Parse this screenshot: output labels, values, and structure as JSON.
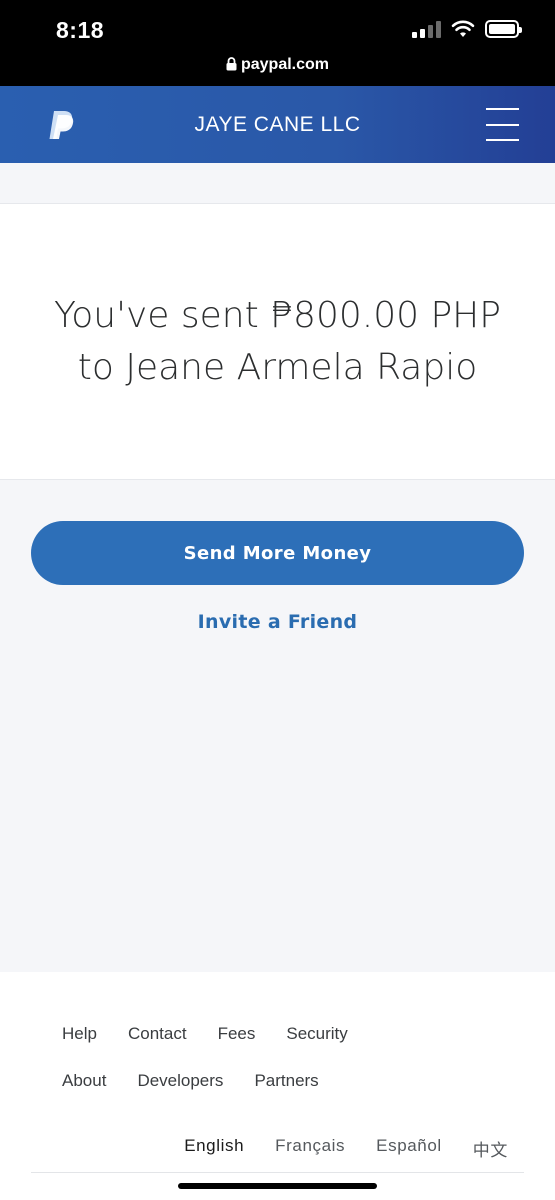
{
  "status_bar": {
    "time": "8:18",
    "url": "paypal.com"
  },
  "header": {
    "merchant": "JAYE CANE LLC",
    "brand_color": "#2a5fb0"
  },
  "confirmation": {
    "message": "You've sent ₱800.00 PHP to Jeane Armela Rapio"
  },
  "actions": {
    "send_more_label": "Send More Money",
    "invite_label": "Invite a Friend",
    "button_color": "#2d6fb8"
  },
  "footer": {
    "links_row1": [
      "Help",
      "Contact",
      "Fees",
      "Security"
    ],
    "links_row2": [
      "About",
      "Developers",
      "Partners"
    ],
    "languages": [
      "English",
      "Français",
      "Español",
      "中文"
    ],
    "active_language": "English"
  }
}
